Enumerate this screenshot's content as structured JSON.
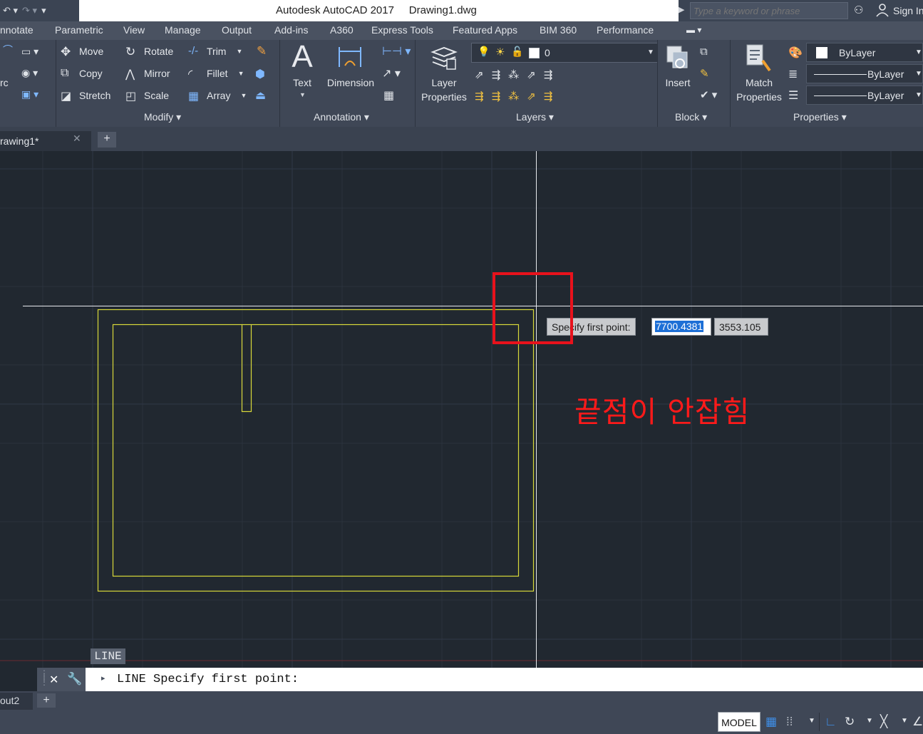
{
  "titlebar": {
    "app_title": "Autodesk AutoCAD 2017     Drawing1.dwg",
    "search_placeholder": "Type a keyword or phrase",
    "sign_in": "Sign In"
  },
  "ribbon_tabs": [
    "nnotate",
    "Parametric",
    "View",
    "Manage",
    "Output",
    "Add-ins",
    "A360",
    "Express Tools",
    "Featured Apps",
    "BIM 360",
    "Performance"
  ],
  "modify": {
    "title": "Modify",
    "move": "Move",
    "rotate": "Rotate",
    "trim": "Trim",
    "copy": "Copy",
    "mirror": "Mirror",
    "fillet": "Fillet",
    "stretch": "Stretch",
    "scale": "Scale",
    "array": "Array"
  },
  "draw_fragment": "rc",
  "annotation": {
    "title": "Annotation",
    "text": "Text",
    "dimension": "Dimension"
  },
  "layers": {
    "title": "Layers",
    "layer_properties_1": "Layer",
    "layer_properties_2": "Properties",
    "current_layer": "0"
  },
  "block": {
    "title": "Block",
    "insert": "Insert"
  },
  "properties": {
    "title": "Properties",
    "match_1": "Match",
    "match_2": "Properties",
    "color": "ByLayer",
    "linetype": "ByLayer",
    "lineweight": "ByLayer"
  },
  "doc_tab": {
    "name": "rawing1*",
    "add": "+"
  },
  "dynamic_input": {
    "prompt": "Specify first point:",
    "x_value": "7700.4381",
    "y_value": "3553.105"
  },
  "annotation_note": "끝점이 안잡힘",
  "command_chip": "LINE",
  "command_line": {
    "text": "LINE Specify first point:"
  },
  "layout_tab": {
    "name": "out2",
    "add": "+"
  },
  "statusbar": {
    "model": "MODEL"
  },
  "colors": {
    "accent_red": "#e8121c",
    "geometry_yellow": "#d8d83a",
    "canvas": "#212830"
  }
}
